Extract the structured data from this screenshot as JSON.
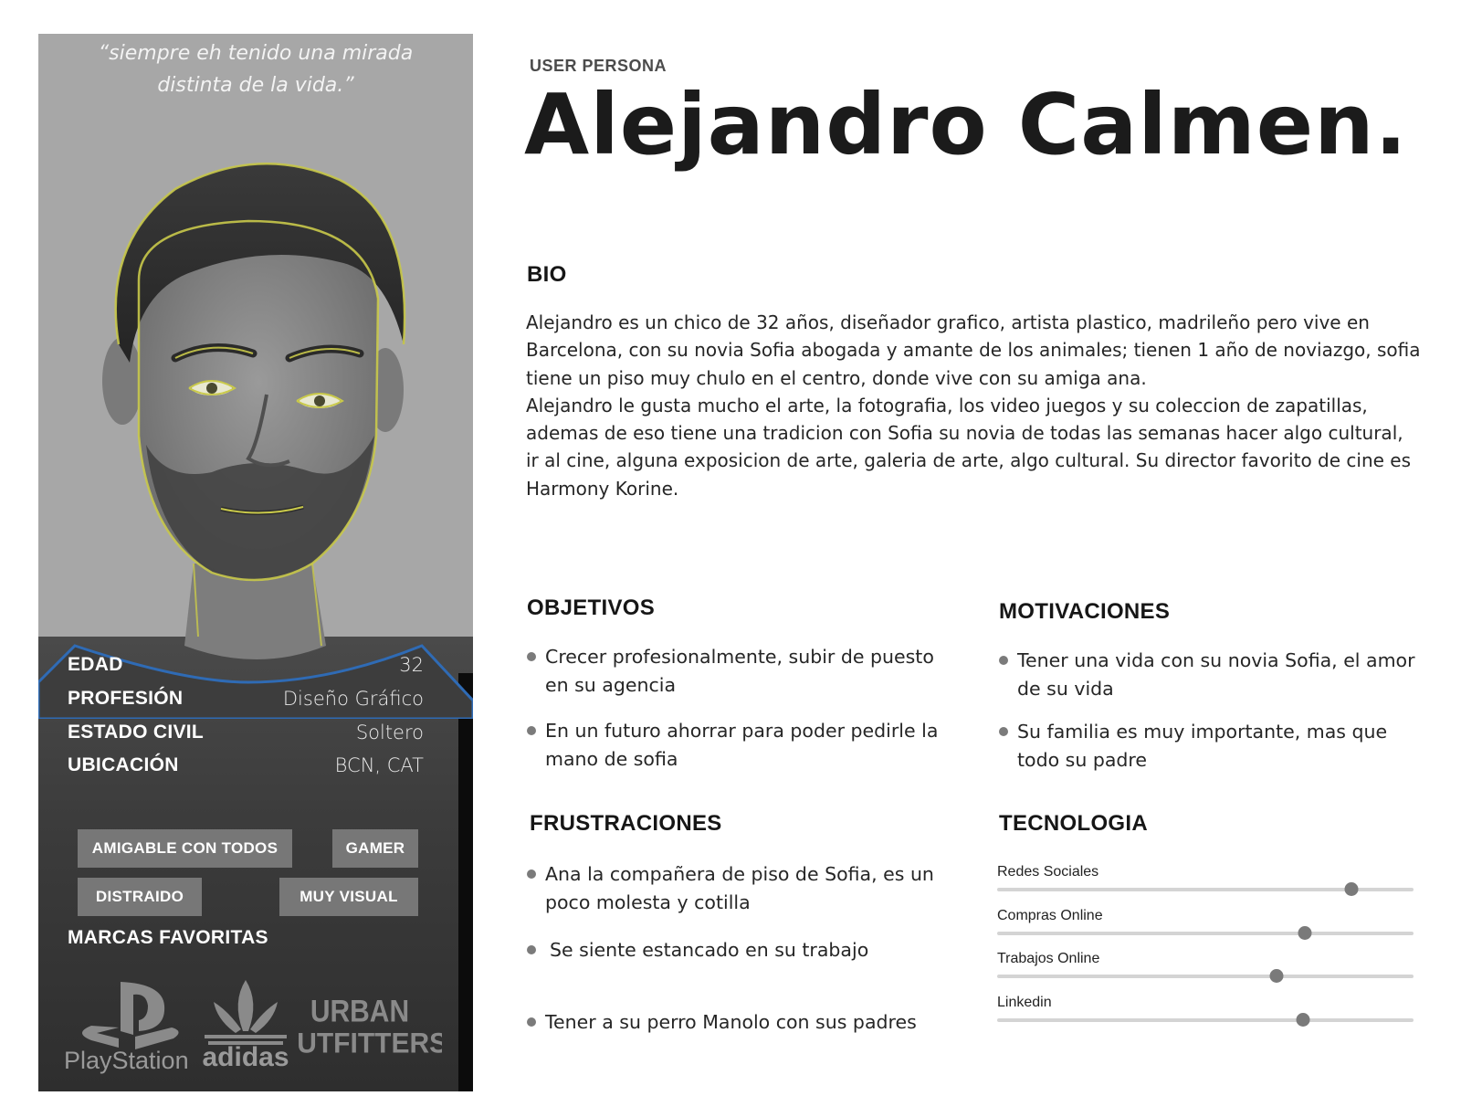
{
  "header": {
    "eyebrow": "USER PERSONA",
    "name": "Alejandro Calmen."
  },
  "card": {
    "quote": "“siempre eh tenido una mirada distinta de la vida.”",
    "info": [
      {
        "label": "EDAD",
        "value": "32"
      },
      {
        "label": "PROFESIÓN",
        "value": "Diseño Gráfico"
      },
      {
        "label": "ESTADO CIVIL",
        "value": "Soltero"
      },
      {
        "label": "UBICACIÓN",
        "value": "BCN, CAT"
      }
    ],
    "tags": [
      "AMIGABLE CON TODOS",
      "GAMER",
      "DISTRAIDO",
      "MUY VISUAL"
    ],
    "brands_title": "MARCAS FAVORITAS",
    "brands": [
      "PlayStation",
      "adidas",
      "URBAN",
      "OUTFITTERS"
    ]
  },
  "bio": {
    "title": "BIO",
    "paragraphs": [
      "Alejandro es un chico de 32 años, diseñador grafico, artista plastico, madrileño pero vive en Barcelona, con su novia Sofia abogada y amante de los animales; tienen 1 año de noviazgo, sofia tiene un piso muy chulo en el centro, donde vive con su amiga ana.",
      "Alejandro le gusta mucho el arte, la fotografia, los video juegos y su coleccion de zapatillas, ademas de eso tiene una tradicion con Sofia su novia de todas las semanas hacer algo cultural, ir al cine, alguna exposicion de arte, galeria de arte, algo cultural. Su director favorito de cine es Harmony Korine."
    ]
  },
  "objetivos": {
    "title": "OBJETIVOS",
    "items": [
      "Crecer profesionalmente, subir de puesto en su agencia",
      "En un futuro ahorrar para poder pedirle la mano de sofia"
    ]
  },
  "motivaciones": {
    "title": "MOTIVACIONES",
    "items": [
      "Tener una vida con su novia Sofia, el amor de su vida",
      "Su familia es muy importante, mas que todo su padre"
    ]
  },
  "frustraciones": {
    "title": "FRUSTRACIONES",
    "items": [
      "Ana la compañera de piso de Sofia, es un poco molesta y cotilla",
      "Se siente estancado en su trabajo",
      "Tener a su perro Manolo con sus padres"
    ]
  },
  "tecnologia": {
    "title": "TECNOLOGIA",
    "items": [
      {
        "label": "Redes Sociales",
        "level": 0.85
      },
      {
        "label": "Compras Online",
        "level": 0.74
      },
      {
        "label": "Trabajos Online",
        "level": 0.67
      },
      {
        "label": "Linkedin",
        "level": 0.735
      }
    ]
  },
  "colors": {
    "card_bg": "#a7a7a7",
    "tag_bg": "#777777",
    "outline_accent": "#c9c94a",
    "sweater_accent": "#2f6bb5"
  }
}
